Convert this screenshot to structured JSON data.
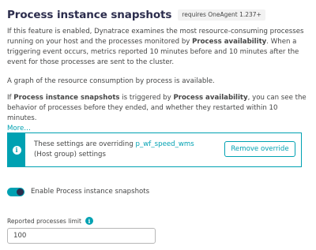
{
  "header": {
    "title": "Process instance snapshots",
    "requirement_badge": "requires OneAgent 1.237+"
  },
  "description": {
    "p1_a": "If this feature is enabled, Dynatrace examines the most resource-consuming processes running on your host and the processes monitored by ",
    "p1_bold": "Process availability",
    "p1_b": ". When a triggering event occurs, metrics reported 10 minutes before and 10 minutes after the event for those processes are sent to the cluster.",
    "p2": "A graph of the resource consumption by process is available.",
    "p3_a": "If ",
    "p3_bold1": "Process instance snapshots",
    "p3_b": " is triggered by ",
    "p3_bold2": "Process availability",
    "p3_c": ", you can see the behavior of processes before they ended, and whether they restarted within 10 minutes.",
    "more_link": "More…"
  },
  "override_notice": {
    "text_before": "These settings are overriding ",
    "link": "p_wf_speed_wms",
    "text_after": " (Host group) settings",
    "button": "Remove override"
  },
  "toggle": {
    "label": "Enable Process instance snapshots",
    "enabled": true
  },
  "limit_field": {
    "label": "Reported processes limit",
    "value": "100"
  },
  "colors": {
    "accent": "#00a1b2",
    "title": "#2c2d4d",
    "text": "#454646"
  }
}
